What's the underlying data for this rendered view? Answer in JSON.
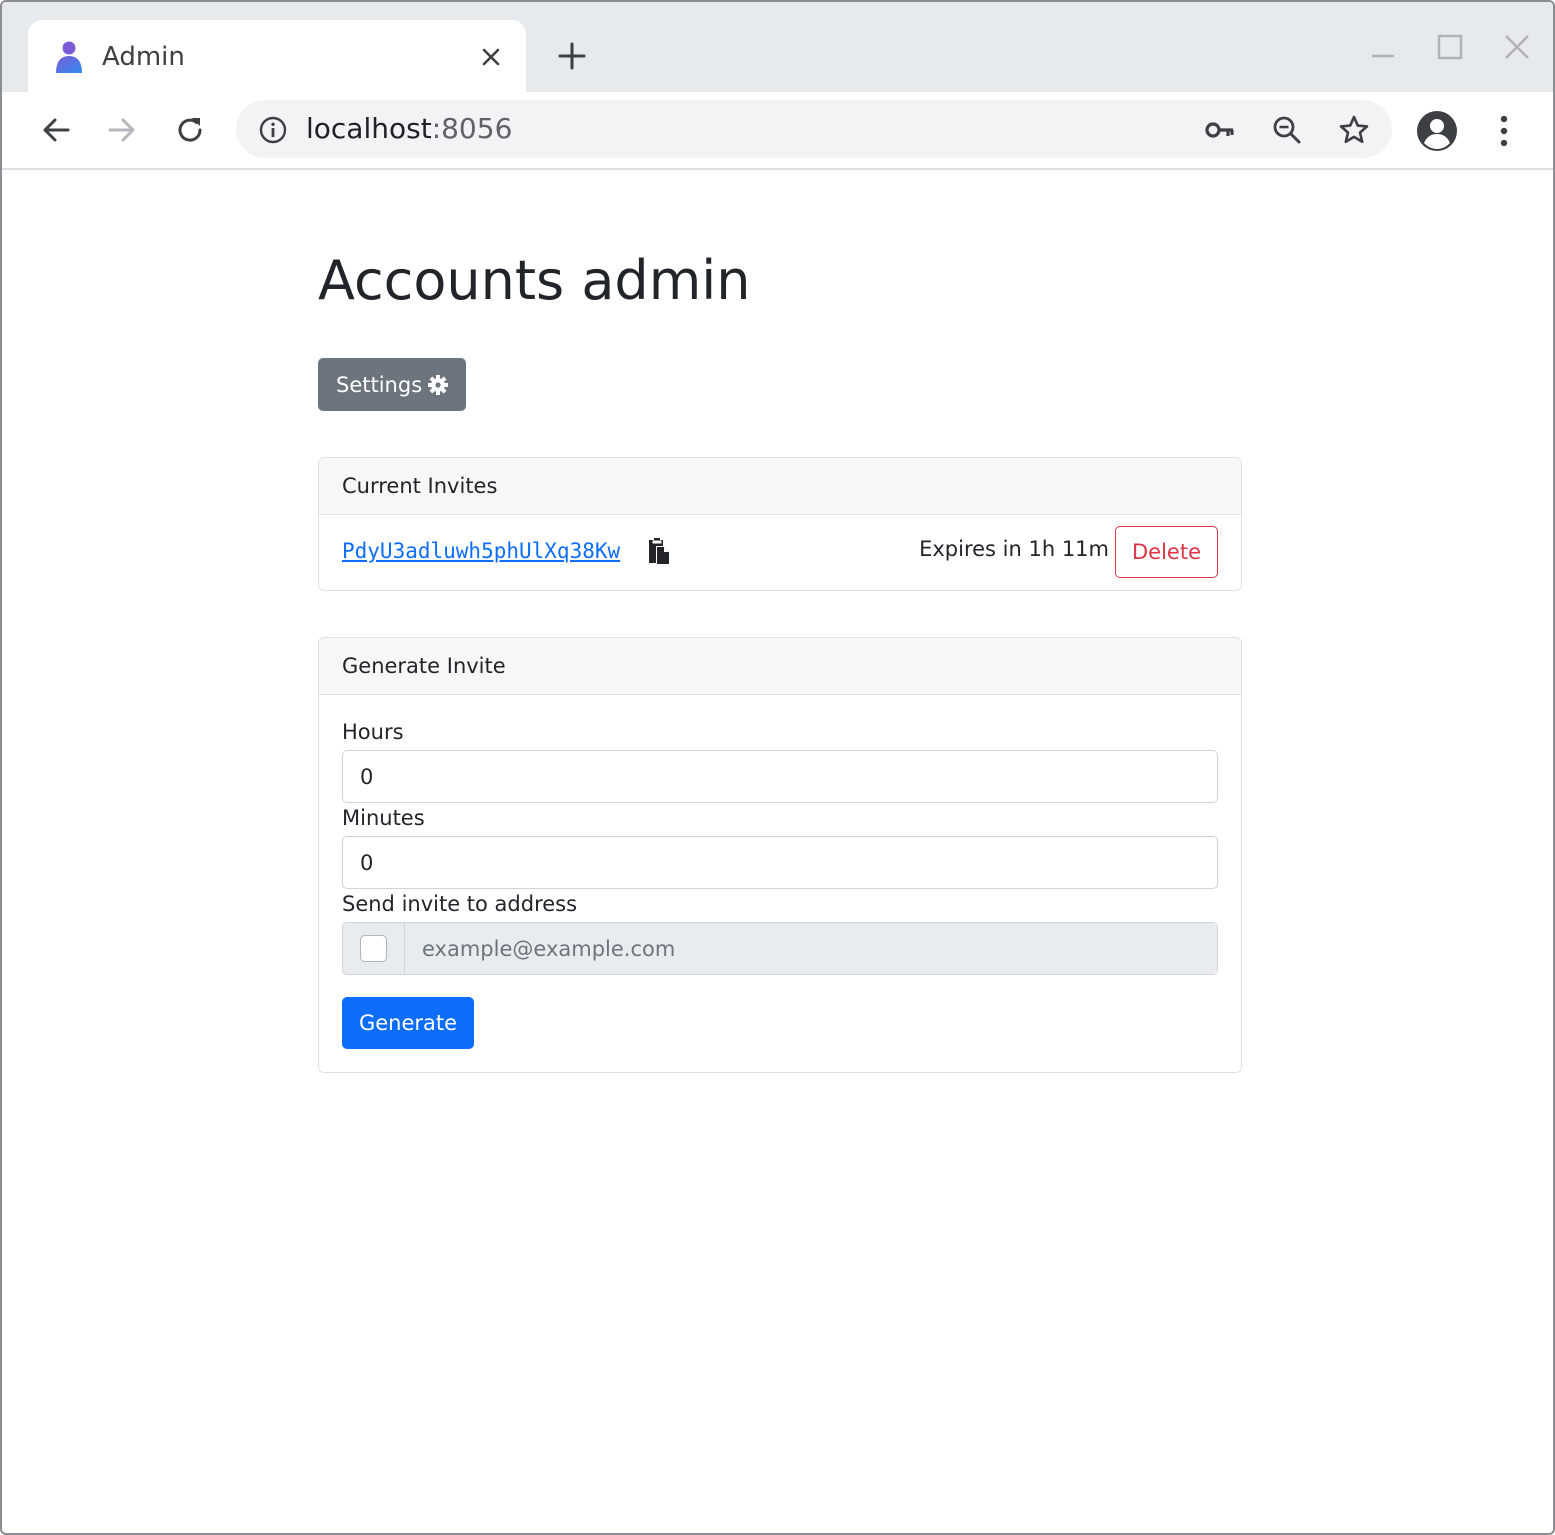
{
  "browser": {
    "tab_title": "Admin",
    "url_host": "localhost",
    "url_port": ":8056"
  },
  "page": {
    "title": "Accounts admin",
    "settings_label": "Settings"
  },
  "current_invites": {
    "header": "Current Invites",
    "invites": [
      {
        "code": "PdyU3adluwh5phUlXq38Kw",
        "expires": "Expires in 1h 11m",
        "delete_label": "Delete"
      }
    ]
  },
  "generate_invite": {
    "header": "Generate Invite",
    "hours_label": "Hours",
    "hours_value": "0",
    "minutes_label": "Minutes",
    "minutes_value": "0",
    "address_label": "Send invite to address",
    "address_placeholder": "example@example.com",
    "generate_label": "Generate"
  },
  "icons": {
    "favicon": "user-icon",
    "settings": "gear-icon",
    "copy": "clipboard-icon"
  },
  "colors": {
    "primary": "#0d6efd",
    "danger": "#dc3545",
    "secondary": "#6c757d"
  }
}
